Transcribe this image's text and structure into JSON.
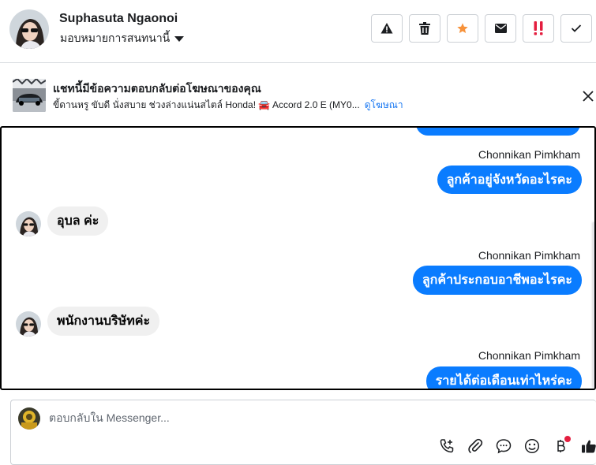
{
  "header": {
    "contact_name": "Suphasuta Ngaonoi",
    "assign_label": "มอบหมายการสนทนานี้",
    "actions": [
      {
        "name": "spam-button",
        "icon": "warning-icon"
      },
      {
        "name": "delete-button",
        "icon": "trash-icon"
      },
      {
        "name": "star-button",
        "icon": "star-icon"
      },
      {
        "name": "mark-unread-button",
        "icon": "envelope-icon"
      },
      {
        "name": "follow-up-button",
        "icon": "double-exclamation-icon"
      },
      {
        "name": "mark-done-button",
        "icon": "checkmark-icon"
      }
    ]
  },
  "ad_banner": {
    "title": "แชทนี้มีข้อความตอบกลับต่อโฆษณาของคุณ",
    "description": "ขี้ดานหรู ขับดี นั่งสบาย ช่วงล่างแน่นสไตล์ Honda! 🚘 Accord 2.0 E (MY0...",
    "link": "ดูโฆษณา"
  },
  "conversation": {
    "messages": [
      {
        "direction": "out",
        "sender": "",
        "text": ""
      },
      {
        "direction": "out",
        "sender": "Chonnikan Pimkham",
        "text": "ลูกค้าอยู่จังหวัดอะไรคะ"
      },
      {
        "direction": "in",
        "text": "อุบล ค่ะ"
      },
      {
        "direction": "out",
        "sender": "Chonnikan Pimkham",
        "text": "ลูกค้าประกอบอาชีพอะไรคะ"
      },
      {
        "direction": "in",
        "text": "พนักงานบริษัทค่ะ"
      },
      {
        "direction": "out",
        "sender": "Chonnikan Pimkham",
        "text": "รายได้ต่อเดือนเท่าไหร่คะ"
      }
    ]
  },
  "composer": {
    "placeholder": "ตอบกลับใน Messenger...",
    "tools": [
      "call-plus-icon",
      "paperclip-icon",
      "chat-bubble-icon",
      "emoji-icon",
      "baht-icon",
      "thumbs-up-icon"
    ]
  },
  "colors": {
    "accent": "#0a7cff",
    "star": "#f7923a",
    "alert": "#e41e3f"
  }
}
